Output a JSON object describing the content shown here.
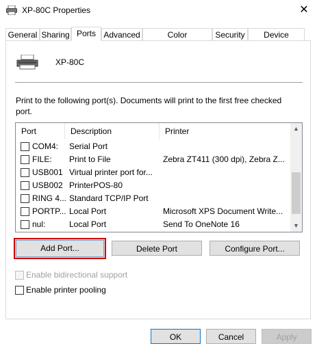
{
  "window": {
    "title": "XP-80C Properties",
    "close_glyph": "✕"
  },
  "tabs": [
    {
      "label": "General"
    },
    {
      "label": "Sharing"
    },
    {
      "label": "Ports",
      "active": true
    },
    {
      "label": "Advanced"
    },
    {
      "label": "Color Management"
    },
    {
      "label": "Security"
    },
    {
      "label": "Device Settings"
    }
  ],
  "printer": {
    "name": "XP-80C",
    "icon": "printer-icon"
  },
  "ports_section": {
    "description": "Print to the following port(s). Documents will print to the first free checked port.",
    "columns": [
      "Port",
      "Description",
      "Printer"
    ],
    "rows": [
      {
        "port": "COM4:",
        "description": "Serial Port",
        "printer": "",
        "checked": false
      },
      {
        "port": "FILE:",
        "description": "Print to File",
        "printer": "Zebra ZT411 (300 dpi), Zebra Z...",
        "checked": false
      },
      {
        "port": "USB001",
        "description": "Virtual printer port for...",
        "printer": "",
        "checked": false
      },
      {
        "port": "USB002",
        "description": "PrinterPOS-80",
        "printer": "",
        "checked": false
      },
      {
        "port": "RING 4...",
        "description": "Standard TCP/IP Port",
        "printer": "",
        "checked": false
      },
      {
        "port": "PORTP...",
        "description": "Local Port",
        "printer": "Microsoft XPS Document Write...",
        "checked": false
      },
      {
        "port": "nul:",
        "description": "Local Port",
        "printer": "Send To OneNote 16",
        "checked": false
      }
    ]
  },
  "port_buttons": {
    "add_port": "Add Port...",
    "delete_port": "Delete Port",
    "configure_port": "Configure Port..."
  },
  "options": {
    "bidirectional": {
      "label": "Enable bidirectional support",
      "checked": false,
      "enabled": false
    },
    "pooling": {
      "label": "Enable printer pooling",
      "checked": false,
      "enabled": true
    }
  },
  "dialog_buttons": {
    "ok": "OK",
    "cancel": "Cancel",
    "apply": "Apply"
  },
  "colors": {
    "focus_highlight": "#cc0000",
    "default_button_border": "#0078d7"
  }
}
